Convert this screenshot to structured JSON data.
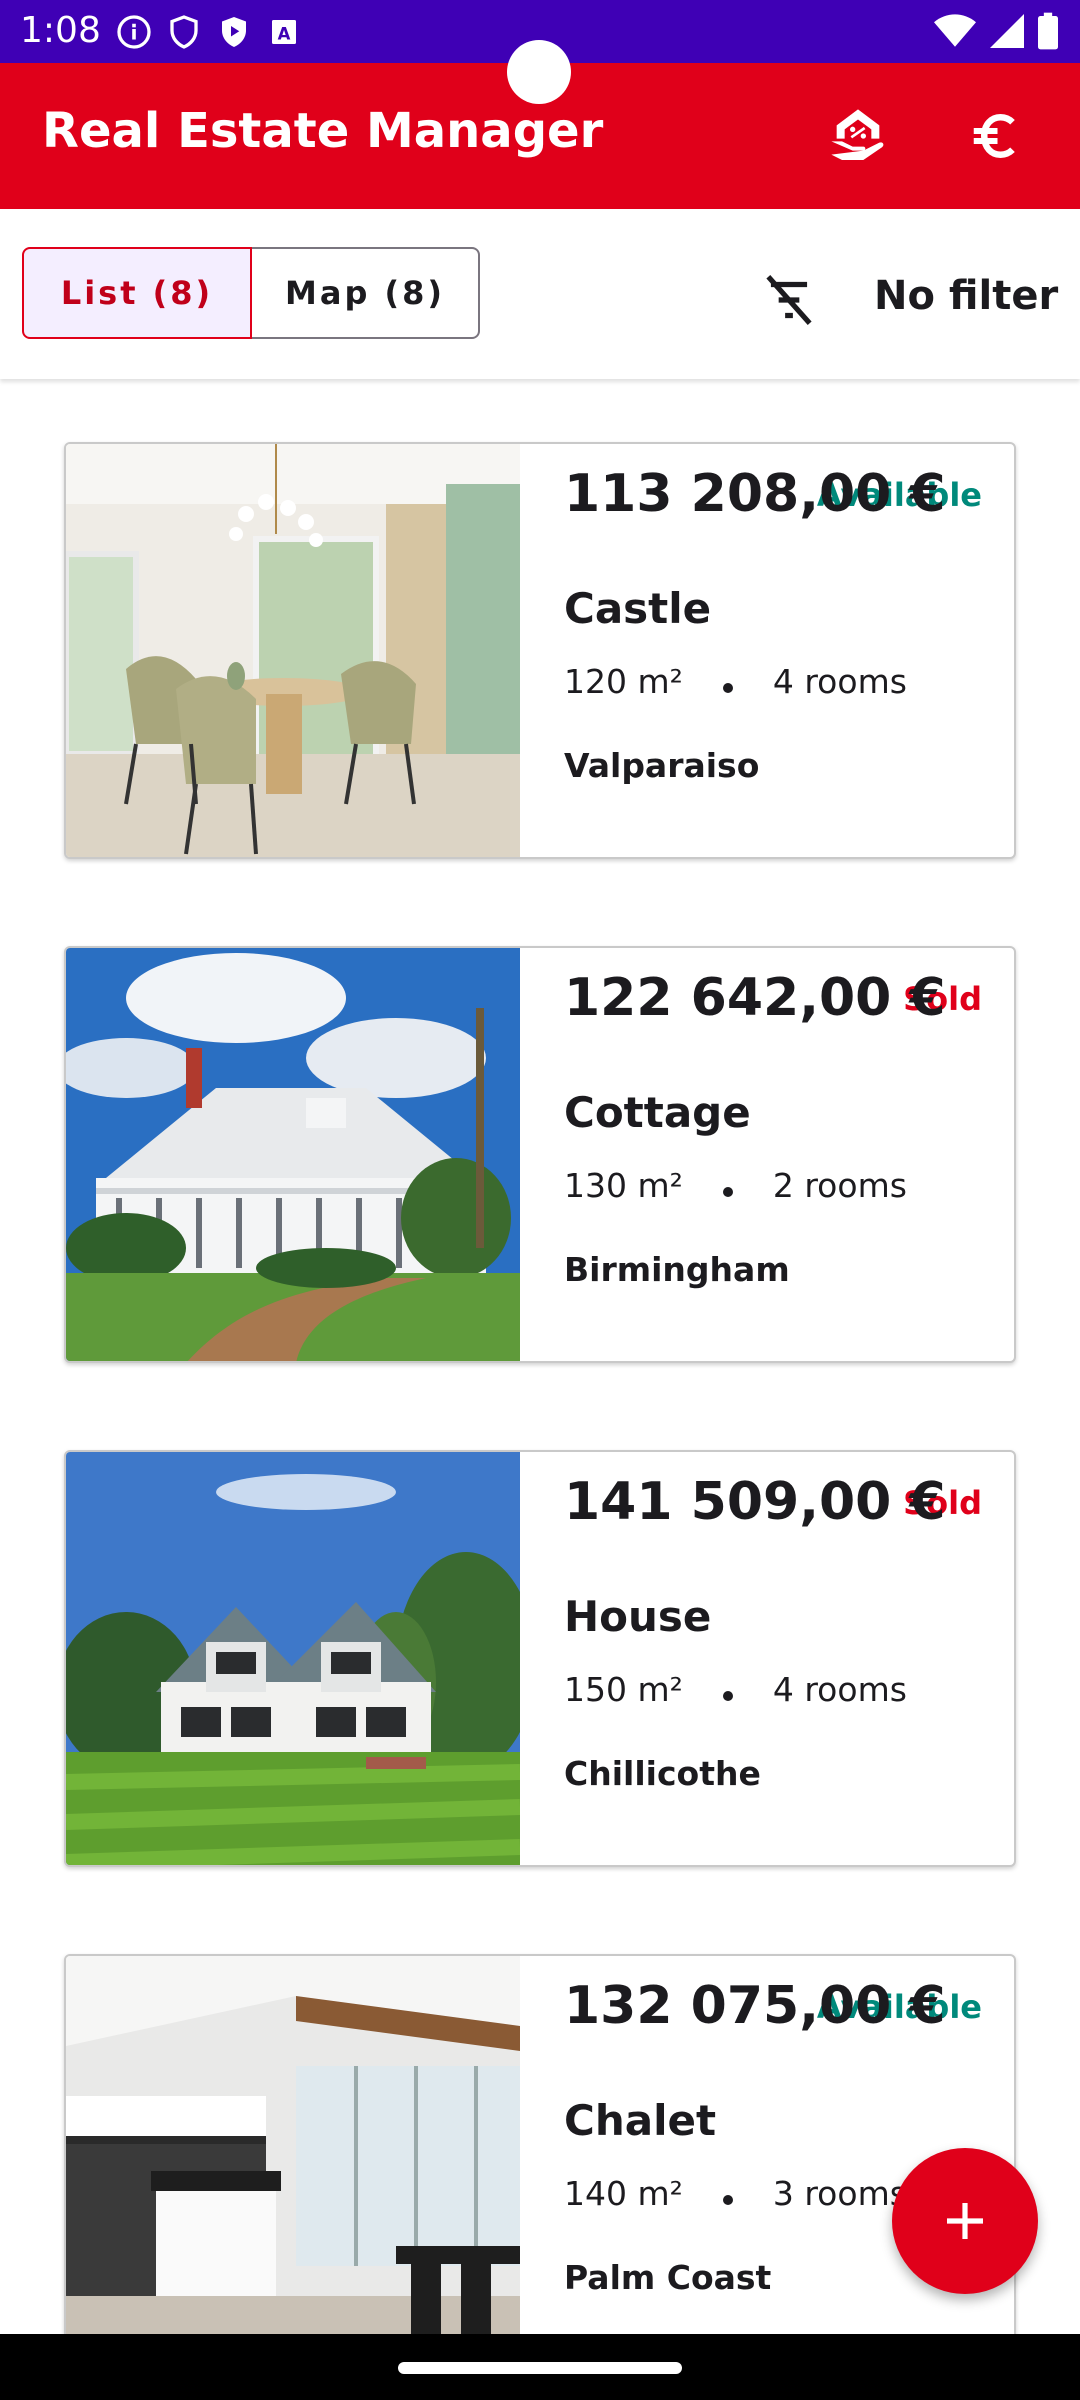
{
  "status_bar": {
    "time": "1:08",
    "left_icons": [
      "info-icon",
      "shield-icon",
      "play-protect-icon",
      "text-icon"
    ],
    "right_icons": [
      "wifi-icon",
      "signal-icon",
      "battery-icon"
    ]
  },
  "app_bar": {
    "title": "Real Estate Manager",
    "actions": [
      "estimate-icon",
      "euro-icon"
    ],
    "color": "#e0001a"
  },
  "toolbar": {
    "tabs": [
      "List (8)",
      "Map (8)"
    ],
    "selected_tab": "List (8)",
    "filter_label": "No filter"
  },
  "listings": [
    {
      "price": "113 208,00 €",
      "type": "Castle",
      "area": "120 m²",
      "rooms": "4 rooms",
      "city": "Valparaiso",
      "status": "Available"
    },
    {
      "price": "122 642,00 €",
      "type": "Cottage",
      "area": "130 m²",
      "rooms": "2 rooms",
      "city": "Birmingham",
      "status": "Sold"
    },
    {
      "price": "141 509,00 €",
      "type": "House",
      "area": "150 m²",
      "rooms": "4 rooms",
      "city": "Chillicothe",
      "status": "Sold"
    },
    {
      "price": "132 075,00 €",
      "type": "Chalet",
      "area": "140 m²",
      "rooms": "3 rooms",
      "city": "Palm Coast",
      "status": "Available"
    }
  ],
  "colors": {
    "available": "#00897b",
    "sold": "#e0001a",
    "primary": "#e0001a",
    "status_bar": "#3f00b5"
  },
  "fab": {
    "icon": "plus-icon"
  }
}
